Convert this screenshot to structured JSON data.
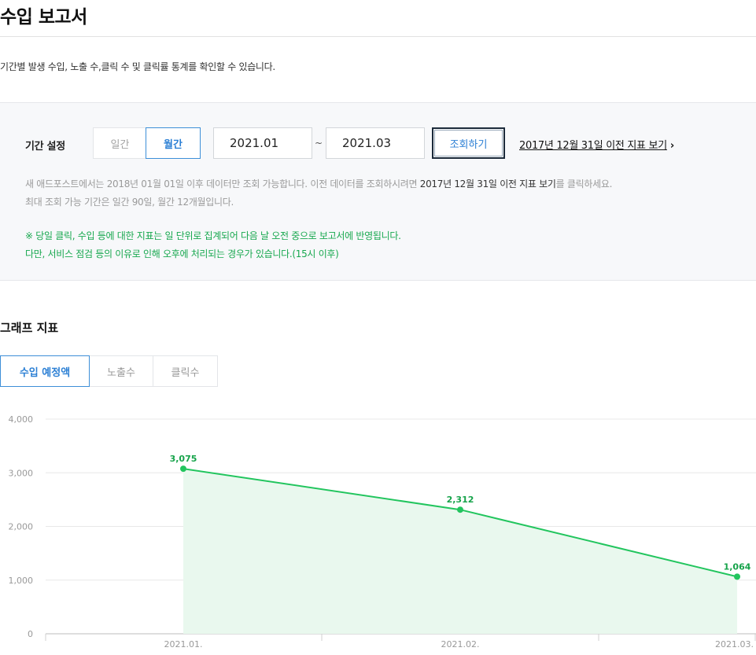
{
  "header": {
    "title": "수입 보고서",
    "description": "기간별 발생 수입, 노출 수,클릭 수 및 클릭률 통계를 확인할 수 있습니다."
  },
  "filter": {
    "label": "기간 설정",
    "period_daily": "일간",
    "period_monthly": "월간",
    "selected_period": "월간",
    "date_from": "2021.01",
    "date_separator": "~",
    "date_to": "2021.03",
    "search_button": "조회하기",
    "prev_link": "2017년 12월 31일 이전 지표 보기",
    "prev_arrow": "›",
    "note1_prefix": "새 애드포스트에서는 2018년 01월 01일 이후 데이터만 조회 가능합니다. 이전 데이터를 조회하시려면 ",
    "note1_link": "2017년 12월 31일 이전 지표 보기",
    "note1_suffix": "를 클릭하세요.",
    "note2": "최대 조회 가능 기간은 일간 90일, 월간 12개월입니다.",
    "green_note1": "※ 당일 클릭, 수입 등에 대한 지표는 일 단위로 집계되어 다음 날 오전 중으로 보고서에 반영됩니다.",
    "green_note2": "다만, 서비스 점검 등의 이유로 인해 오후에 처리되는 경우가 있습니다.(15시 이후)"
  },
  "graph": {
    "section_title": "그래프 지표",
    "tabs": [
      {
        "label": "수입 예정액",
        "active": true
      },
      {
        "label": "노출수",
        "active": false
      },
      {
        "label": "클릭수",
        "active": false
      }
    ]
  },
  "chart_data": {
    "type": "area",
    "categories": [
      "2021.01.",
      "2021.02.",
      "2021.03."
    ],
    "values": [
      3075,
      2312,
      1064
    ],
    "data_labels": [
      "3,075",
      "2,312",
      "1,064"
    ],
    "y_ticks": [
      "0",
      "1,000",
      "2,000",
      "3,000",
      "4,000"
    ],
    "y_tick_values": [
      0,
      1000,
      2000,
      3000,
      4000
    ],
    "ylim": [
      0,
      4000
    ],
    "grid": true,
    "colors": {
      "line": "#22c55e",
      "fill": "#e9f8ee",
      "label": "#16a34a",
      "grid": "#e8e8e8"
    }
  },
  "colors": {
    "accent": "#2b7fd4",
    "notice_green": "#18a84f",
    "panel_bg": "#f7f8fa"
  }
}
